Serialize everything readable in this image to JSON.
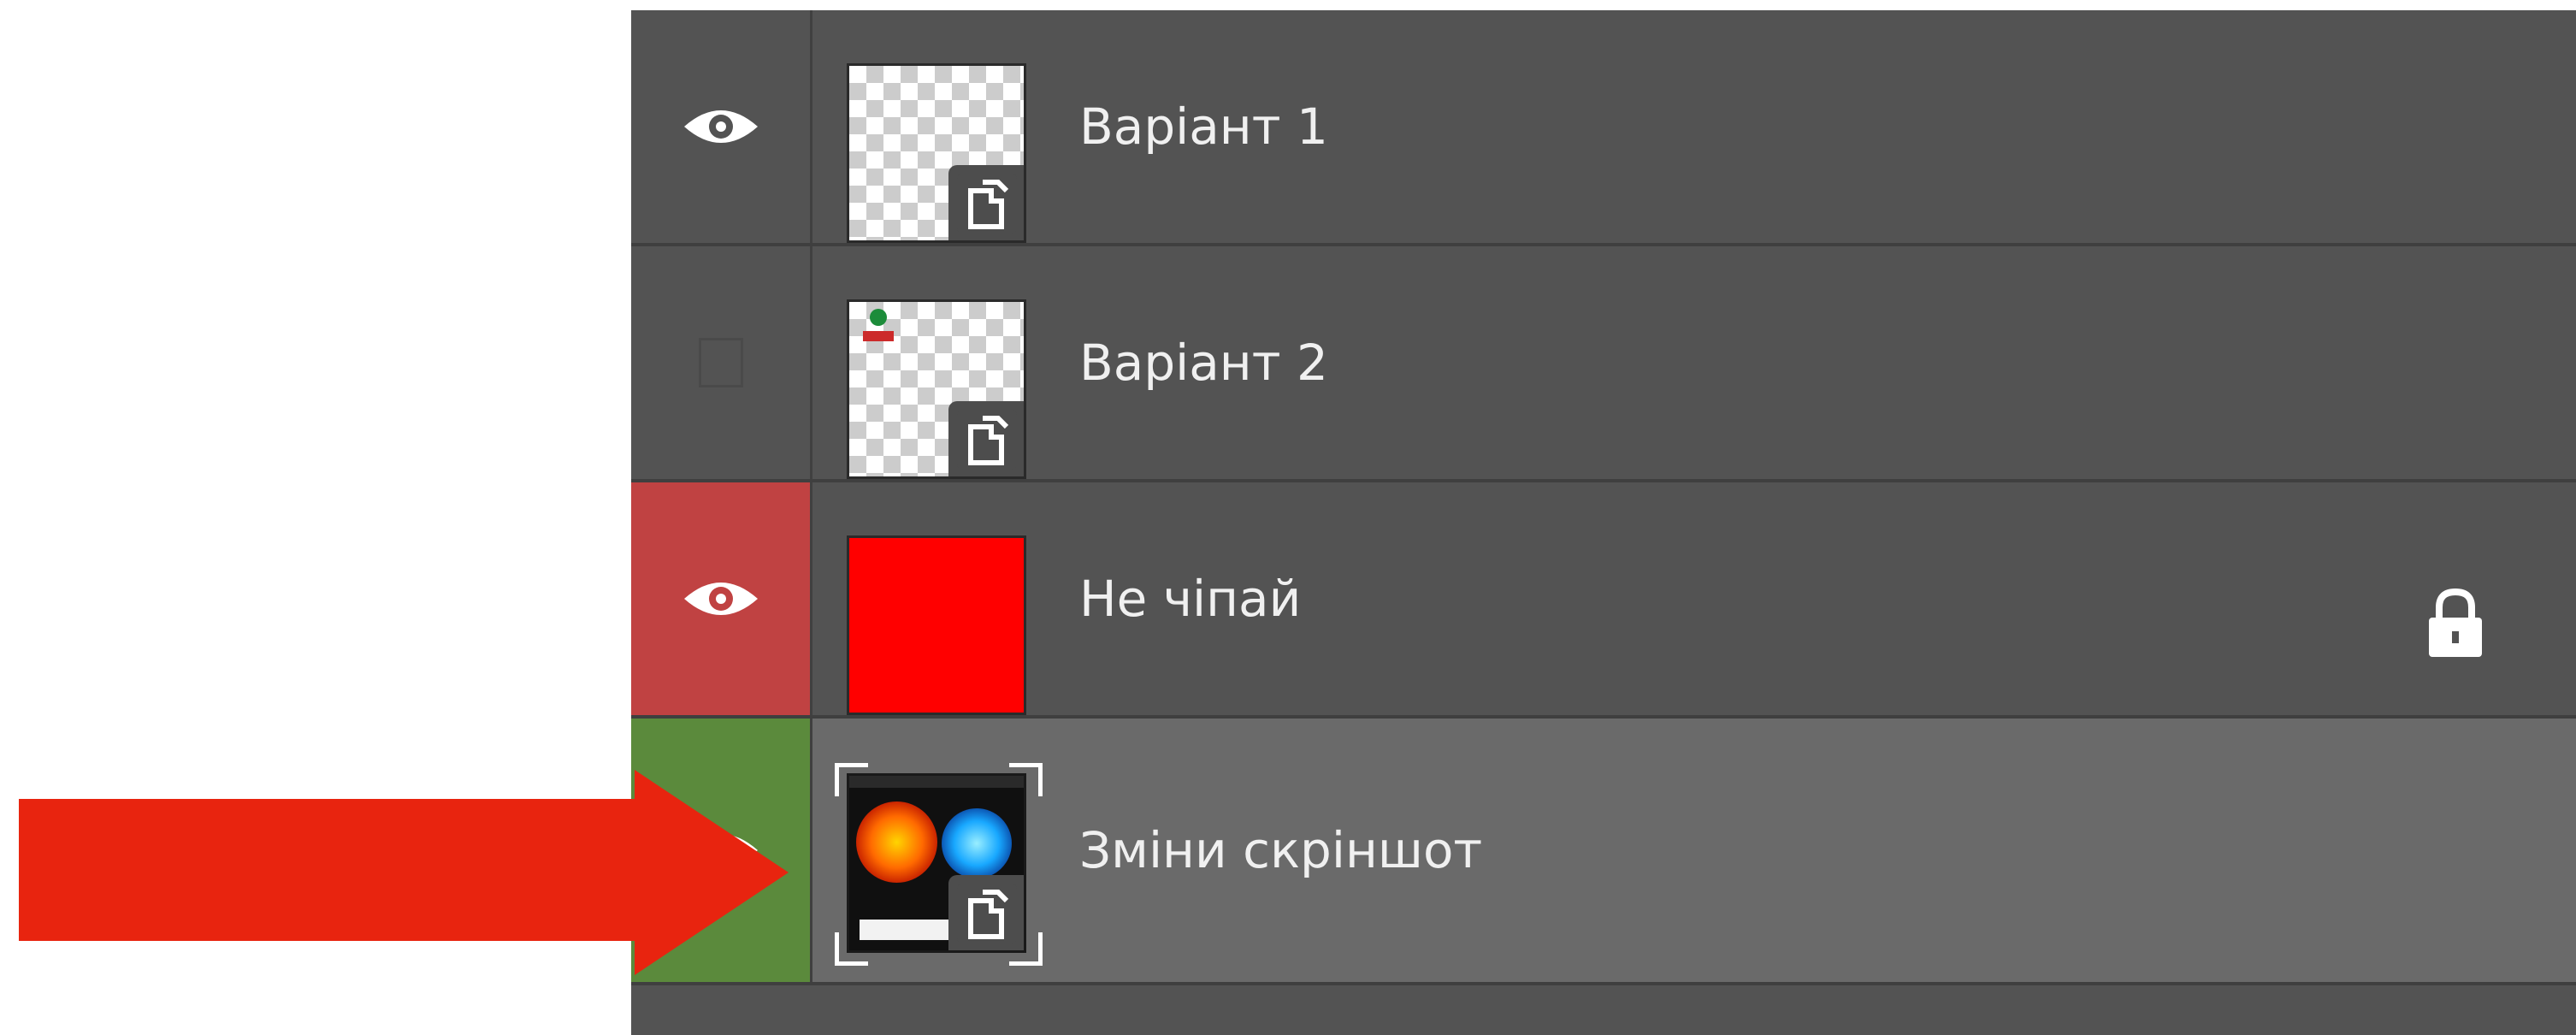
{
  "layers_panel": {
    "layers": [
      {
        "name": "Варіант 1",
        "visible": true,
        "thumbnail": "transparent",
        "smart_object": true,
        "locked": false,
        "color_label": "none"
      },
      {
        "name": "Варіант 2",
        "visible": false,
        "thumbnail": "transparent",
        "smart_object": true,
        "locked": false,
        "color_label": "none"
      },
      {
        "name": "Не чіпай",
        "visible": true,
        "thumbnail": "solid-red",
        "smart_object": false,
        "locked": true,
        "color_label": "red"
      },
      {
        "name": "Зміни скріншот",
        "visible": true,
        "thumbnail": "image",
        "smart_object": true,
        "locked": false,
        "color_label": "green",
        "selected": true
      }
    ]
  },
  "annotation": {
    "type": "arrow",
    "color": "#e8240f",
    "points_to": "Зміни скріншот"
  },
  "colors": {
    "panel_bg": "#535353",
    "selected_row": "#6a6a6a",
    "label_red": "#c04242",
    "label_green": "#5b8a3c",
    "thumb_red": "#ff0000",
    "text": "#f0f0f0"
  },
  "icons": {
    "visibility": "eye-icon",
    "smart_object": "smart-object-badge-icon",
    "lock": "lock-icon"
  }
}
